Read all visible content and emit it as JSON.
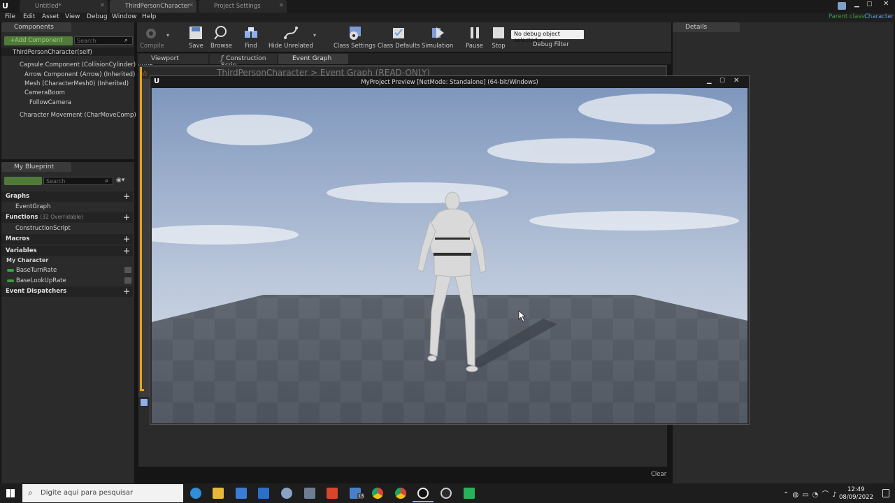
{
  "tabs": [
    {
      "label": "Untitled*"
    },
    {
      "label": "ThirdPersonCharacter"
    },
    {
      "label": "Project Settings"
    }
  ],
  "parent_class": {
    "label": "Parent class:",
    "value": "Character"
  },
  "menu": [
    "File",
    "Edit",
    "Asset",
    "View",
    "Debug",
    "Window",
    "Help"
  ],
  "components": {
    "title": "Components",
    "add_button": "+Add Component",
    "search_placeholder": "Search",
    "tree": [
      "ThirdPersonCharacter(self)",
      "Capsule Component (CollisionCylinder) (Inhe",
      "Arrow Component (Arrow) (Inherited)",
      "Mesh (CharacterMesh0) (Inherited)",
      "CameraBoom",
      "FollowCamera",
      "Character Movement (CharMoveComp) (Inhe"
    ]
  },
  "toolbar": {
    "compile": "Compile",
    "save": "Save",
    "browse": "Browse",
    "find": "Find",
    "hide_unrelated": "Hide Unrelated",
    "class_settings": "Class Settings",
    "class_defaults": "Class Defaults",
    "simulation": "Simulation",
    "pause": "Pause",
    "stop": "Stop",
    "debug_select": "No debug object selected",
    "debug_filter": "Debug Filter"
  },
  "editor_tabs": {
    "viewport": "Viewport",
    "construction": "Construction Scrip",
    "event_graph": "Event Graph"
  },
  "breadcrumb": {
    "root": "ThirdPersonCharacter",
    "sep": ">",
    "graph": "Event Graph",
    "mode": "(READ-ONLY)"
  },
  "details": {
    "title": "Details"
  },
  "my_blueprint": {
    "title": "My Blueprint",
    "search_placeholder": "Search",
    "graphs": "Graphs",
    "event_graph": "EventGraph",
    "functions": "Functions",
    "functions_count": "(32 Overridable)",
    "construction_script": "ConstructionScript",
    "macros": "Macros",
    "variables": "Variables",
    "category": "My Character",
    "vars": [
      "BaseTurnRate",
      "BaseLookUpRate"
    ],
    "event_dispatchers": "Event Dispatchers"
  },
  "preview": {
    "title": "MyProject Preview [NetMode: Standalone]  (64-bit/Windows)"
  },
  "output": {
    "clear": "Clear"
  },
  "taskbar": {
    "search_placeholder": "Digite aqui para pesquisar",
    "time": "12:49",
    "date": "08/09/2022",
    "badge": "13"
  },
  "colors": {
    "accent_orange": "#e8a317",
    "var_green": "#3c9e3c",
    "sky_top": "#7f97bd",
    "floor": "#545a64"
  }
}
